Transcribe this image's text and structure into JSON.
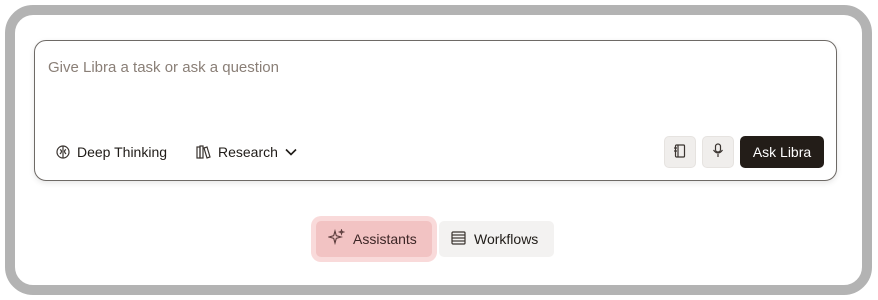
{
  "composer": {
    "placeholder": "Give Libra a task or ask a question",
    "value": "",
    "deep_thinking_label": "Deep Thinking",
    "research_label": "Research",
    "ask_label": "Ask Libra"
  },
  "tabs": [
    {
      "label": "Assistants",
      "selected": true,
      "icon": "sparkles-icon"
    },
    {
      "label": "Workflows",
      "selected": false,
      "icon": "list-icon"
    }
  ],
  "colors": {
    "ask_button": "#231d18",
    "selected_tab": "#f2c3c3",
    "frame_border": "#b3b3b3"
  }
}
